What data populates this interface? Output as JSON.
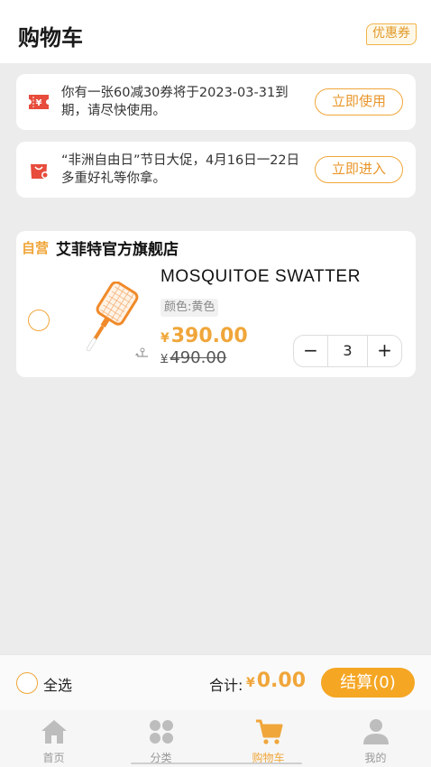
{
  "header": {
    "title": "购物车",
    "coupon_badge": "优惠券"
  },
  "notices": [
    {
      "icon": "coupon-ticket-icon",
      "text": "你有一张60减30券将于2023-03-31到期，请尽快使用。",
      "button": "立即使用"
    },
    {
      "icon": "shopping-bag-icon",
      "text": "“非洲自由日”节日大促，4月16日一22日 多重好礼等你拿。",
      "button": "立即进入"
    }
  ],
  "shop": {
    "tag": "自营",
    "name": "艾菲特官方旗舰店",
    "item": {
      "name": "MOSQUITOE SWATTER",
      "spec": "颜色:黄色",
      "currency": "¥",
      "price": "390.00",
      "old_price": "490.00",
      "quantity": "3",
      "minus": "−",
      "plus": "+"
    }
  },
  "checkout": {
    "select_all": "全选",
    "total_label": "合计:",
    "currency": "¥",
    "total": "0.00",
    "button": "结算(0)"
  },
  "tabs": [
    {
      "label": "首页",
      "icon": "home-icon",
      "active": false
    },
    {
      "label": "分类",
      "icon": "category-icon",
      "active": false
    },
    {
      "label": "购物车",
      "icon": "cart-icon",
      "active": true
    },
    {
      "label": "我的",
      "icon": "user-icon",
      "active": false
    }
  ],
  "colors": {
    "accent": "#f0a63a",
    "checkout_button": "#f5a623",
    "coupon_icon": "#e74c3c"
  }
}
